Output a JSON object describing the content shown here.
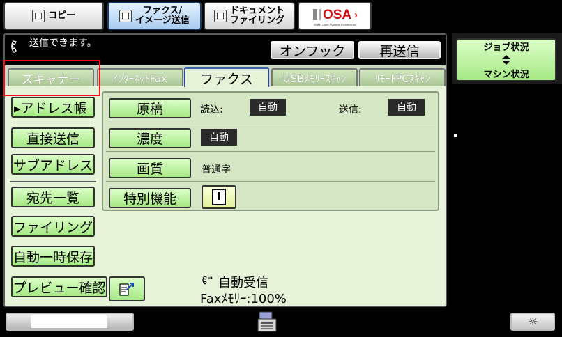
{
  "mode_tabs": [
    {
      "label": "コピー",
      "icon": "copy-icon"
    },
    {
      "label": "ファクス/\nイメージ送信",
      "icon": "fax-icon"
    },
    {
      "label": "ドキュメント\nファイリング",
      "icon": "document-filing-icon"
    }
  ],
  "osa_logo": {
    "text": "OSA",
    "subtext": "Sharp Open Systems Architecture"
  },
  "status_message": "送信できます。",
  "header_buttons": {
    "on_hook": "オンフック",
    "resend": "再送信"
  },
  "tabs": [
    {
      "label": "スキャナー"
    },
    {
      "label": "ｲﾝﾀｰﾈｯﾄFax"
    },
    {
      "label": "ファクス",
      "active": true
    },
    {
      "label": "USBﾒﾓﾘｰｽｷｬﾝ"
    },
    {
      "label": "ﾘﾓｰﾄPCｽｷｬﾝ"
    }
  ],
  "side_buttons": {
    "address_book": "▸アドレス帳",
    "direct_send": "直接送信",
    "sub_address": "サブアドレス",
    "destination_list": "宛先一覧",
    "filing": "ファイリング",
    "auto_temp_save": "自動一時保存",
    "preview_confirm": "プレビュー確認"
  },
  "settings": {
    "original_label": "原稿",
    "read_label": "読込:",
    "read_value": "自動",
    "send_label": "送信:",
    "send_value": "自動",
    "density_label": "濃度",
    "density_value": "自動",
    "quality_label": "画質",
    "quality_value": "普通字",
    "special_label": "特別機能"
  },
  "receive": {
    "mode": "自動受信",
    "memory": "Faxﾒﾓﾘｰ:100%"
  },
  "job_status": {
    "line1": "ジョブ状況",
    "line2": "マシン状況"
  },
  "colors": {
    "panel_green": "#e6f3d8",
    "button_green": "#a6e884",
    "highlight_red": "#e11111",
    "active_tab_blue": "#3a5fb0"
  }
}
